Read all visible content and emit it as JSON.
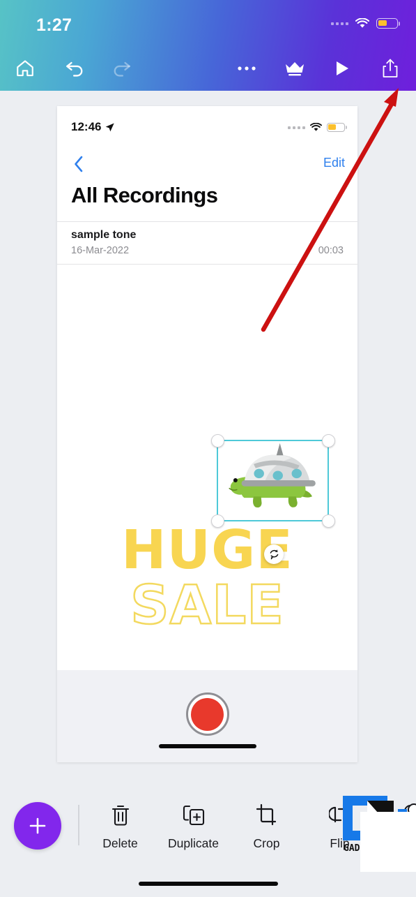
{
  "app": {
    "header": {
      "status": {
        "time": "1:27",
        "signal_dots": 4,
        "wifi_icon": "wifi-icon",
        "battery_icon": "battery-low-power-icon",
        "battery_color": "#fbc02d"
      },
      "gradient_from": "#57c3c6",
      "gradient_to": "#6f1fdc",
      "buttons": [
        {
          "name": "home-button",
          "icon": "home-icon",
          "enabled": true
        },
        {
          "name": "undo-button",
          "icon": "undo-arrow-icon",
          "enabled": true
        },
        {
          "name": "redo-button",
          "icon": "redo-arrow-icon",
          "enabled": false
        },
        {
          "name": "more-options-button",
          "icon": "ellipsis-icon",
          "enabled": true
        },
        {
          "name": "pro-crown-button",
          "icon": "crown-icon",
          "enabled": true
        },
        {
          "name": "play-preview-button",
          "icon": "play-triangle-icon",
          "enabled": true
        },
        {
          "name": "share-export-button",
          "icon": "share-upload-icon",
          "enabled": true
        }
      ]
    },
    "annotation": {
      "arrow_color": "#cc1111",
      "points_to": "share-export-button"
    },
    "canvas": {
      "screenshot": {
        "status": {
          "time": "12:46",
          "location_icon": "location-arrow-icon",
          "signal_dots": 4,
          "wifi_icon": "wifi-icon",
          "battery_icon": "battery-low-power-icon"
        },
        "nav": {
          "back_icon": "chevron-left-icon",
          "edit_label": "Edit"
        },
        "title": "All Recordings",
        "recordings": [
          {
            "name": "sample tone",
            "date": "16-Mar-2022",
            "duration": "00:03"
          }
        ],
        "record_button": {
          "name": "record-button",
          "color": "#e8392c"
        },
        "home_indicator": "home-indicator"
      },
      "selection": {
        "border_color": "#4ec9d8",
        "handles": 4,
        "rotate_icon": "rotate-icon"
      },
      "graphic": {
        "name": "turtle-ufo-sticker",
        "shell_color": "#d9dbdc",
        "body_color": "#8cc63f"
      },
      "text_elements": [
        {
          "name": "huge-text",
          "value": "HUGE",
          "style": "filled",
          "color": "#f8d551"
        },
        {
          "name": "sale-text",
          "value": "SALE",
          "style": "outlined",
          "color": "#f3d95f"
        }
      ]
    },
    "bottom_toolbar": {
      "add_button": {
        "name": "add-button",
        "icon": "plus-icon",
        "color": "#8227ec"
      },
      "tools": [
        {
          "name": "delete-tool",
          "icon": "trash-icon",
          "label": "Delete"
        },
        {
          "name": "duplicate-tool",
          "icon": "duplicate-icon",
          "label": "Duplicate"
        },
        {
          "name": "crop-tool",
          "icon": "crop-icon",
          "label": "Crop"
        },
        {
          "name": "flip-tool",
          "icon": "flip-icon",
          "label": "Flip"
        },
        {
          "name": "layers-tool",
          "icon": "layers-icon",
          "label": ""
        }
      ],
      "home_indicator": "home-indicator"
    },
    "watermark": {
      "name": "gadgets-watermark",
      "primary_color": "#1779e8"
    }
  }
}
